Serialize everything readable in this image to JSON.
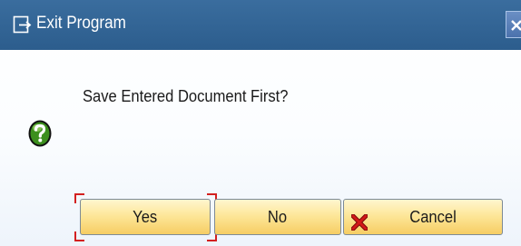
{
  "window": {
    "title": "Exit Program",
    "title_icon": "exit-program-icon",
    "close_icon": "close-icon"
  },
  "dialog": {
    "message": "Save Entered Document First?",
    "message_icon": "question-icon"
  },
  "buttons": {
    "yes_label": "Yes",
    "no_label": "No",
    "cancel_label": "Cancel",
    "cancel_icon": "red-x-icon",
    "focused": "Yes"
  },
  "colors": {
    "titlebar": "#2c5d8d",
    "button_fill": "#fde79a",
    "focus": "#d32020",
    "question_icon": "#3c8f1d",
    "cancel_icon": "#d31818"
  }
}
